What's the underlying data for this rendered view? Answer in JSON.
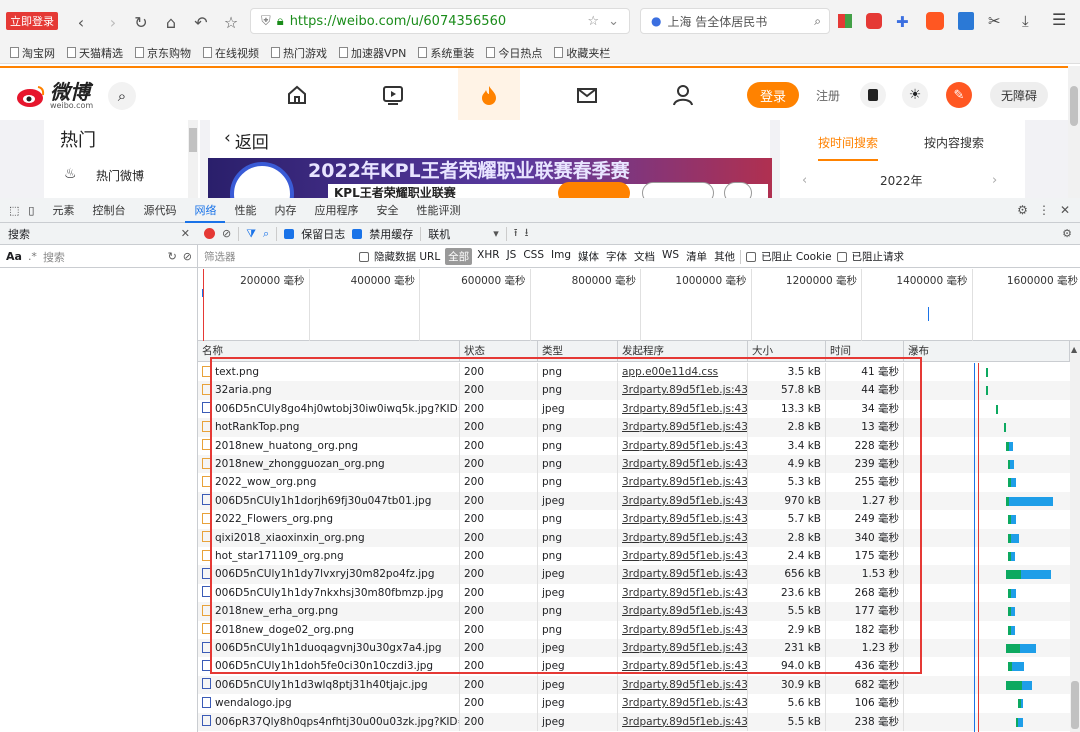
{
  "browser": {
    "login_badge": "立即登录",
    "url": "https://weibo.com/u/6074356560",
    "location": "上海 告全体居民书",
    "bookmarks": [
      "淘宝网",
      "天猫精选",
      "京东购物",
      "在线视频",
      "热门游戏",
      "加速器VPN",
      "系统重装",
      "今日热点",
      "收藏夹栏"
    ]
  },
  "weibo": {
    "logo_text": "微博",
    "logo_sub": "weibo.com",
    "login": "登录",
    "register": "注册",
    "accessibility": "无障碍",
    "hot_title": "热门",
    "hot_item": "热门微博",
    "back": "返回",
    "banner_title": "2022年KPL王者荣耀职业联赛春季赛",
    "banner_sub": "KPL王者荣耀职业联赛",
    "search_by_time": "按时间搜索",
    "search_by_content": "按内容搜索",
    "year": "2022年"
  },
  "devtools": {
    "tabs": [
      "元素",
      "控制台",
      "源代码",
      "网络",
      "性能",
      "内存",
      "应用程序",
      "安全",
      "性能评测"
    ],
    "active_tab": "网络",
    "left_header": "搜索",
    "left_search_placeholder": "搜索",
    "aa": "Aa",
    "preserve_log": "保留日志",
    "disable_cache": "禁用缓存",
    "throttle": "联机",
    "filter_placeholder": "筛选器",
    "hide_data_url": "隐藏数据 URL",
    "filter_all": "全部",
    "filter_types": [
      "XHR",
      "JS",
      "CSS",
      "Img",
      "媒体",
      "字体",
      "文档",
      "WS",
      "清单",
      "其他"
    ],
    "blocked_cookie": "已阻止 Cookie",
    "blocked_req": "已阻止请求",
    "timeline_labels": [
      "200000 毫秒",
      "400000 毫秒",
      "600000 毫秒",
      "800000 毫秒",
      "1000000 毫秒",
      "1200000 毫秒",
      "1400000 毫秒",
      "1600000 毫秒"
    ],
    "columns": [
      "名称",
      "状态",
      "类型",
      "发起程序",
      "大小",
      "时间",
      "瀑布"
    ],
    "rows": [
      {
        "name": "text.png",
        "status": "200",
        "type": "png",
        "initiator": "app.e00e11d4.css",
        "size": "3.5 kB",
        "time": "41 毫秒"
      },
      {
        "name": "32aria.png",
        "status": "200",
        "type": "png",
        "initiator": "3rdparty.89d5f1eb.js:43",
        "size": "57.8 kB",
        "time": "44 毫秒"
      },
      {
        "name": "006D5nCUly8go4hj0wtobj30iw0iwq5k.jpg?KID=i...",
        "status": "200",
        "type": "jpeg",
        "initiator": "3rdparty.89d5f1eb.js:43",
        "size": "13.3 kB",
        "time": "34 毫秒"
      },
      {
        "name": "hotRankTop.png",
        "status": "200",
        "type": "png",
        "initiator": "3rdparty.89d5f1eb.js:43",
        "size": "2.8 kB",
        "time": "13 毫秒"
      },
      {
        "name": "2018new_huatong_org.png",
        "status": "200",
        "type": "png",
        "initiator": "3rdparty.89d5f1eb.js:43",
        "size": "3.4 kB",
        "time": "228 毫秒"
      },
      {
        "name": "2018new_zhongguozan_org.png",
        "status": "200",
        "type": "png",
        "initiator": "3rdparty.89d5f1eb.js:43",
        "size": "4.9 kB",
        "time": "239 毫秒"
      },
      {
        "name": "2022_wow_org.png",
        "status": "200",
        "type": "png",
        "initiator": "3rdparty.89d5f1eb.js:43",
        "size": "5.3 kB",
        "time": "255 毫秒"
      },
      {
        "name": "006D5nCUly1h1dorjh69fj30u047tb01.jpg",
        "status": "200",
        "type": "jpeg",
        "initiator": "3rdparty.89d5f1eb.js:43",
        "size": "970 kB",
        "time": "1.27 秒"
      },
      {
        "name": "2022_Flowers_org.png",
        "status": "200",
        "type": "png",
        "initiator": "3rdparty.89d5f1eb.js:43",
        "size": "5.7 kB",
        "time": "249 毫秒"
      },
      {
        "name": "qixi2018_xiaoxinxin_org.png",
        "status": "200",
        "type": "png",
        "initiator": "3rdparty.89d5f1eb.js:43",
        "size": "2.8 kB",
        "time": "340 毫秒"
      },
      {
        "name": "hot_star171109_org.png",
        "status": "200",
        "type": "png",
        "initiator": "3rdparty.89d5f1eb.js:43",
        "size": "2.4 kB",
        "time": "175 毫秒"
      },
      {
        "name": "006D5nCUly1h1dy7lvxryj30m82po4fz.jpg",
        "status": "200",
        "type": "jpeg",
        "initiator": "3rdparty.89d5f1eb.js:43",
        "size": "656 kB",
        "time": "1.53 秒"
      },
      {
        "name": "006D5nCUly1h1dy7nkxhsj30m80fbmzp.jpg",
        "status": "200",
        "type": "jpeg",
        "initiator": "3rdparty.89d5f1eb.js:43",
        "size": "23.6 kB",
        "time": "268 毫秒"
      },
      {
        "name": "2018new_erha_org.png",
        "status": "200",
        "type": "png",
        "initiator": "3rdparty.89d5f1eb.js:43",
        "size": "5.5 kB",
        "time": "177 毫秒"
      },
      {
        "name": "2018new_doge02_org.png",
        "status": "200",
        "type": "png",
        "initiator": "3rdparty.89d5f1eb.js:43",
        "size": "2.9 kB",
        "time": "182 毫秒"
      },
      {
        "name": "006D5nCUly1h1duoqagvnj30u30gx7a4.jpg",
        "status": "200",
        "type": "jpeg",
        "initiator": "3rdparty.89d5f1eb.js:43",
        "size": "231 kB",
        "time": "1.23 秒"
      },
      {
        "name": "006D5nCUly1h1doh5fe0ci30n10czdi3.jpg",
        "status": "200",
        "type": "jpeg",
        "initiator": "3rdparty.89d5f1eb.js:43",
        "size": "94.0 kB",
        "time": "436 毫秒"
      },
      {
        "name": "006D5nCUly1h1d3wlq8ptj31h40tjajc.jpg",
        "status": "200",
        "type": "jpeg",
        "initiator": "3rdparty.89d5f1eb.js:43",
        "size": "30.9 kB",
        "time": "682 毫秒"
      },
      {
        "name": "wendalogo.jpg",
        "status": "200",
        "type": "jpeg",
        "initiator": "3rdparty.89d5f1eb.js:43",
        "size": "5.6 kB",
        "time": "106 毫秒"
      },
      {
        "name": "006pR37Qly8h0qps4nfhtj30u00u03zk.jpg?KID=i...",
        "status": "200",
        "type": "jpeg",
        "initiator": "3rdparty.89d5f1eb.js:43",
        "size": "5.5 kB",
        "time": "238 毫秒"
      }
    ]
  },
  "colors": {
    "accent": "#ff8200",
    "devtools_blue": "#1a73e8",
    "highlight_box": "#e53935",
    "waterfall_wait": "#0da960",
    "waterfall_download": "#1e9ee8"
  }
}
